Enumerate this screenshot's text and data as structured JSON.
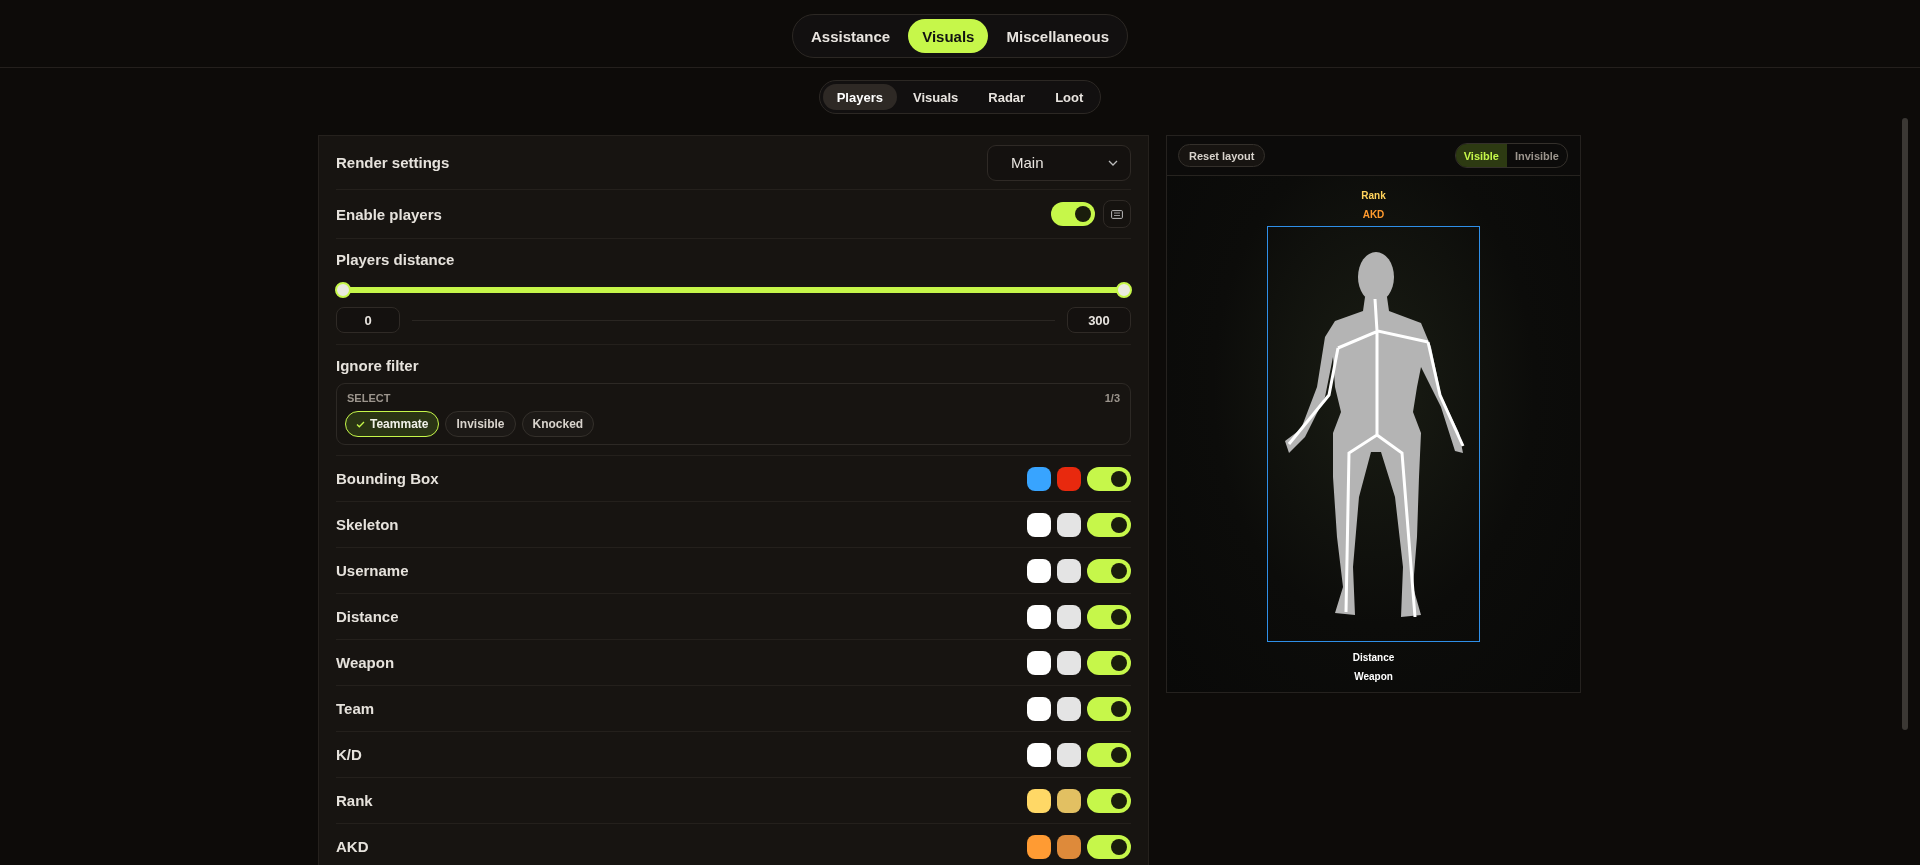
{
  "main_tabs": [
    {
      "label": "Assistance",
      "selected": false
    },
    {
      "label": "Visuals",
      "selected": true
    },
    {
      "label": "Miscellaneous",
      "selected": false
    }
  ],
  "sub_tabs": [
    {
      "label": "Players",
      "selected": true
    },
    {
      "label": "Visuals",
      "selected": false
    },
    {
      "label": "Radar",
      "selected": false
    },
    {
      "label": "Loot",
      "selected": false
    }
  ],
  "settings": {
    "render": {
      "label": "Render settings",
      "dropdown": "Main"
    },
    "enable": {
      "label": "Enable players",
      "on": true
    },
    "distance": {
      "label": "Players distance",
      "thumbs": [
        {
          "level": 0
        },
        {
          "level": 1
        }
      ],
      "min": "0",
      "max": "300"
    },
    "filter": {
      "label": "Ignore filter",
      "caption": "SELECT",
      "count": "1/3",
      "options": [
        {
          "label": "Teammate",
          "selected": true
        },
        {
          "label": "Invisible",
          "selected": false
        },
        {
          "label": "Knocked",
          "selected": false
        }
      ]
    },
    "rows": [
      {
        "label": "Bounding Box",
        "swatches": [
          {
            "color": "#38a4ff"
          },
          {
            "color": "#e8290e"
          }
        ],
        "on": true
      },
      {
        "label": "Skeleton",
        "swatches": [
          {
            "color": "#ffffff"
          },
          {
            "color": "#e4e4e4"
          }
        ],
        "on": true
      },
      {
        "label": "Username",
        "swatches": [
          {
            "color": "#ffffff"
          },
          {
            "color": "#e4e4e4"
          }
        ],
        "on": true
      },
      {
        "label": "Distance",
        "swatches": [
          {
            "color": "#ffffff"
          },
          {
            "color": "#e4e4e4"
          }
        ],
        "on": true
      },
      {
        "label": "Weapon",
        "swatches": [
          {
            "color": "#ffffff"
          },
          {
            "color": "#e4e4e4"
          }
        ],
        "on": true
      },
      {
        "label": "Team",
        "swatches": [
          {
            "color": "#ffffff"
          },
          {
            "color": "#e4e4e4"
          }
        ],
        "on": true
      },
      {
        "label": "K/D",
        "swatches": [
          {
            "color": "#ffffff"
          },
          {
            "color": "#e4e4e4"
          }
        ],
        "on": true
      },
      {
        "label": "Rank",
        "swatches": [
          {
            "color": "#ffd866"
          },
          {
            "color": "#e2c062"
          }
        ],
        "on": true
      },
      {
        "label": "AKD",
        "swatches": [
          {
            "color": "#ff9b33"
          },
          {
            "color": "#de8a3a"
          }
        ],
        "on": true
      }
    ]
  },
  "preview": {
    "reset": "Reset layout",
    "modes": [
      {
        "label": "Visible",
        "selected": true
      },
      {
        "label": "Invisible",
        "selected": false
      }
    ],
    "labels_above": [
      {
        "text": "Rank",
        "color": "#ffd35c"
      },
      {
        "text": "AKD",
        "color": "#ff9a2e"
      }
    ],
    "labels_below": [
      {
        "text": "Distance",
        "color": "#ffffff"
      },
      {
        "text": "Weapon",
        "color": "#ffffff"
      }
    ]
  }
}
